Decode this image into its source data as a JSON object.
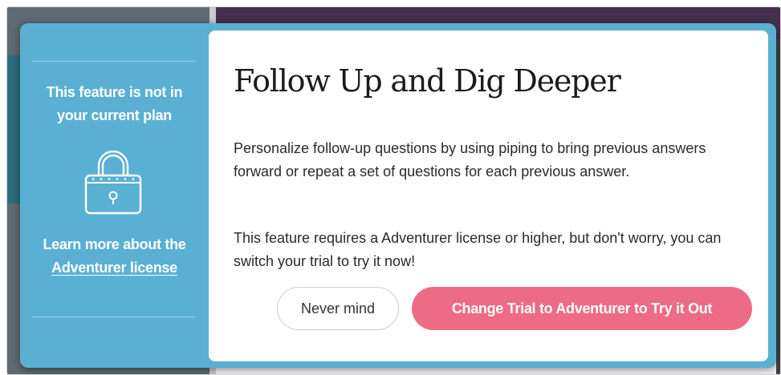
{
  "modal": {
    "side": {
      "plan_line1": "This feature is not in",
      "plan_line2": "your current plan",
      "learn_line1": "Learn more about the",
      "learn_link": "Adventurer license",
      "icon": "lock-icon"
    },
    "title": "Follow Up and Dig Deeper",
    "paragraph1": "Personalize follow-up questions by using piping to bring previous answers forward or repeat a set of questions for each previous answer.",
    "paragraph2": "This feature requires a Adventurer license or higher, but don't worry, you can switch your trial to try it now!",
    "buttons": {
      "never_mind": "Never mind",
      "change_trial": "Change Trial to Adventurer to Try it Out"
    }
  },
  "colors": {
    "side_panel": "#59b0d3",
    "primary_button": "#ed6b84",
    "app_header": "#44304d"
  }
}
